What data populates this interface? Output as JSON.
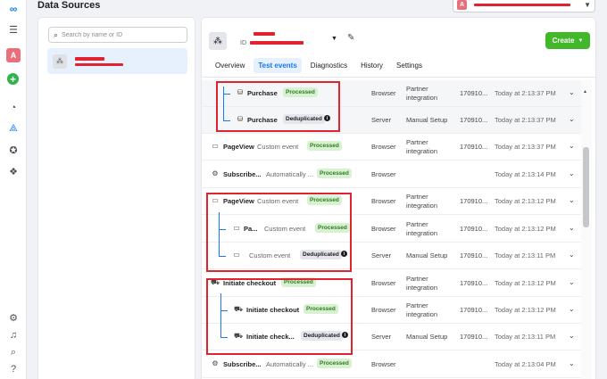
{
  "header": {
    "title": "Data Sources"
  },
  "account": {
    "initial": "A"
  },
  "rail": {
    "avatar_initial": "A"
  },
  "search": {
    "placeholder": "Search by name or ID"
  },
  "main": {
    "id_prefix": "ID",
    "create_label": "Create",
    "tabs": [
      {
        "label": "Overview"
      },
      {
        "label": "Test events",
        "active": true
      },
      {
        "label": "Diagnostics"
      },
      {
        "label": "History"
      },
      {
        "label": "Settings"
      }
    ]
  },
  "events": [
    {
      "icon": "purchase-icon",
      "name": "Purchase",
      "type": "",
      "status": "Processed",
      "source": "Browser",
      "method": "Partner integration",
      "id": "170910...",
      "time": "Today at 2:13:37 PM"
    },
    {
      "icon": "purchase-icon",
      "name": "Purchase",
      "type": "",
      "status": "Deduplicated",
      "source": "Server",
      "method": "Manual Setup",
      "id": "170910...",
      "time": "Today at 2:13:37 PM"
    },
    {
      "icon": "pageview-icon",
      "name": "PageView",
      "type": "Custom event",
      "status": "Processed",
      "source": "Browser",
      "method": "Partner integration",
      "id": "170910...",
      "time": "Today at 2:13:37 PM"
    },
    {
      "icon": "subscribe-icon",
      "name": "Subscribe...",
      "type": "Automatically ...",
      "status": "Processed",
      "source": "Browser",
      "method": "",
      "id": "",
      "time": "Today at 2:13:14 PM"
    },
    {
      "icon": "pageview-icon",
      "name": "PageView",
      "type": "Custom event",
      "status": "Processed",
      "source": "Browser",
      "method": "Partner integration",
      "id": "170910...",
      "time": "Today at 2:13:12 PM"
    },
    {
      "icon": "pageview-icon",
      "name": "Pa...",
      "type": "Custom event",
      "status": "Processed",
      "source": "Browser",
      "method": "Partner integration",
      "id": "170910...",
      "time": "Today at 2:13:12 PM"
    },
    {
      "icon": "pageview-icon",
      "name": "",
      "type": "Custom event",
      "status": "Deduplicated",
      "source": "Server",
      "method": "Manual Setup",
      "id": "170910...",
      "time": "Today at 2:13:11 PM"
    },
    {
      "icon": "cart-icon",
      "name": "Initiate checkout",
      "type": "",
      "status": "Processed",
      "source": "Browser",
      "method": "Partner integration",
      "id": "170910...",
      "time": "Today at 2:13:12 PM"
    },
    {
      "icon": "cart-icon",
      "name": "Initiate checkout",
      "type": "",
      "status": "Processed",
      "source": "Browser",
      "method": "Partner integration",
      "id": "170910...",
      "time": "Today at 2:13:12 PM"
    },
    {
      "icon": "cart-icon",
      "name": "Initiate check...",
      "type": "",
      "status": "Deduplicated",
      "source": "Server",
      "method": "Manual Setup",
      "id": "170910...",
      "time": "Today at 2:13:11 PM"
    },
    {
      "icon": "subscribe-icon",
      "name": "Subscribe...",
      "type": "Automatically ...",
      "status": "Processed",
      "source": "Browser",
      "method": "",
      "id": "",
      "time": "Today at 2:13:04 PM"
    }
  ]
}
